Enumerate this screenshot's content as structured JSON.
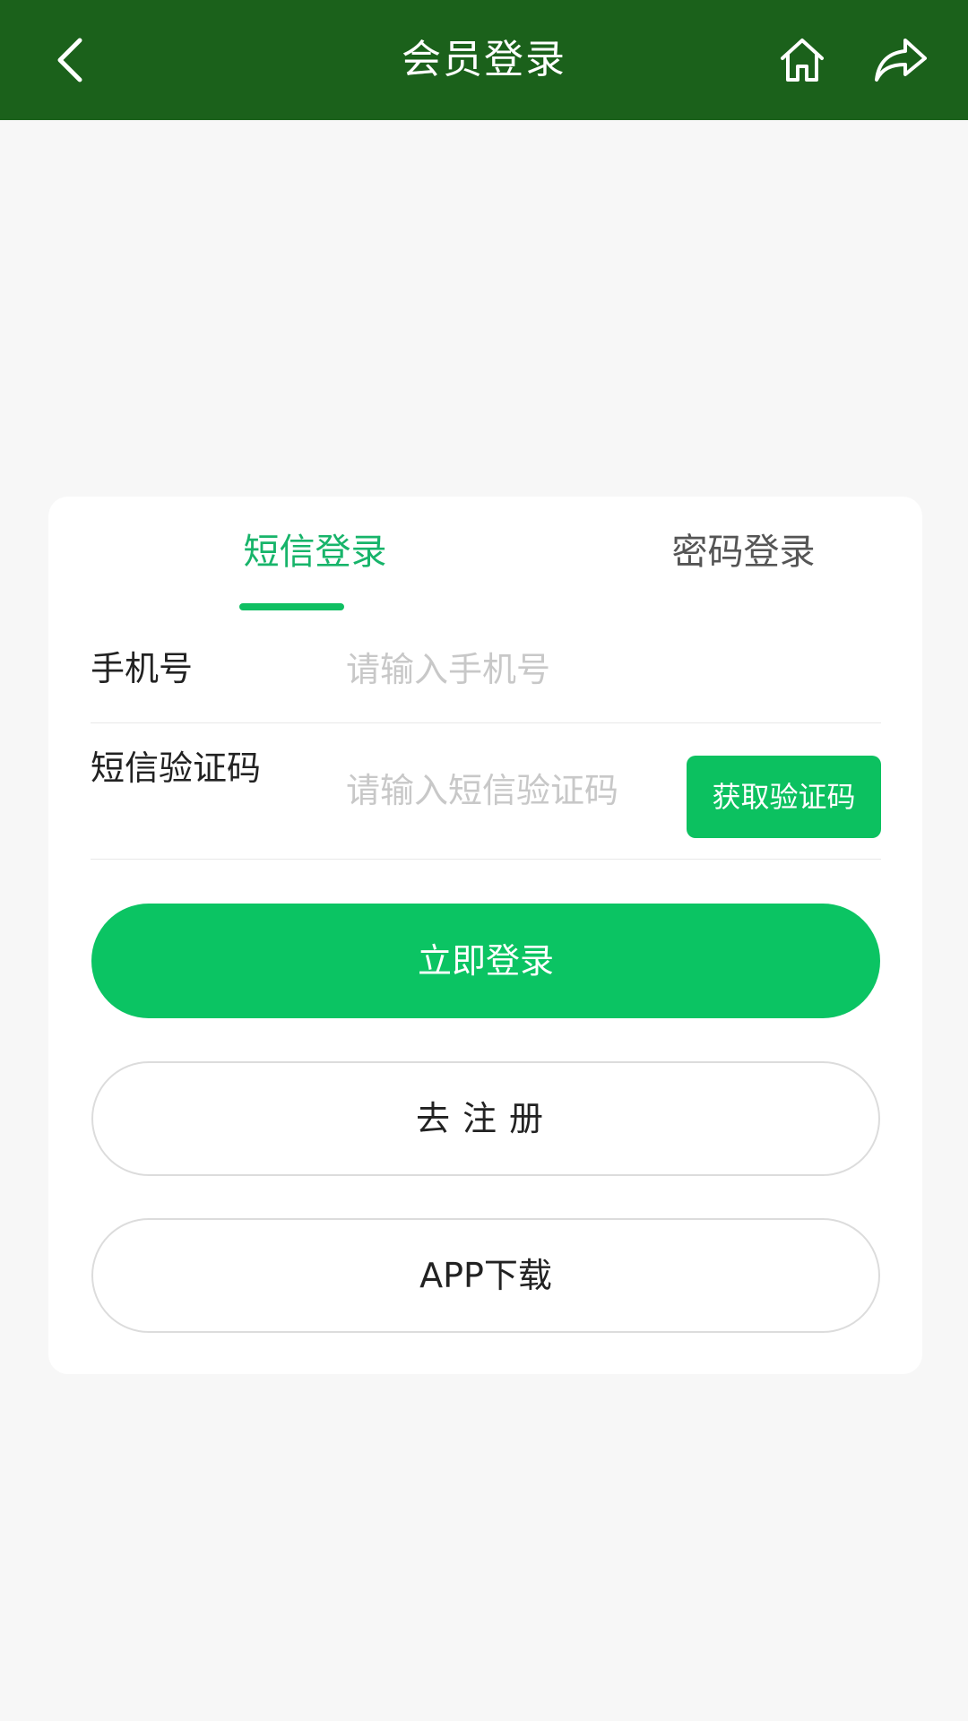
{
  "header": {
    "title": "会员登录",
    "background": "#1b611b",
    "icons": [
      "back-icon",
      "home-icon",
      "share-icon"
    ]
  },
  "tabs": {
    "sms": "短信登录",
    "password": "密码登录",
    "active": "sms",
    "active_color": "#17b46a"
  },
  "form": {
    "phone_label": "手机号",
    "phone_placeholder": "请输入手机号",
    "code_label": "短信验证码",
    "code_placeholder": "请输入短信验证码",
    "get_code_button": "获取验证码"
  },
  "buttons": {
    "login": "立即登录",
    "register": "去注册",
    "app_download": "APP下载",
    "accent": "#0bc463"
  }
}
